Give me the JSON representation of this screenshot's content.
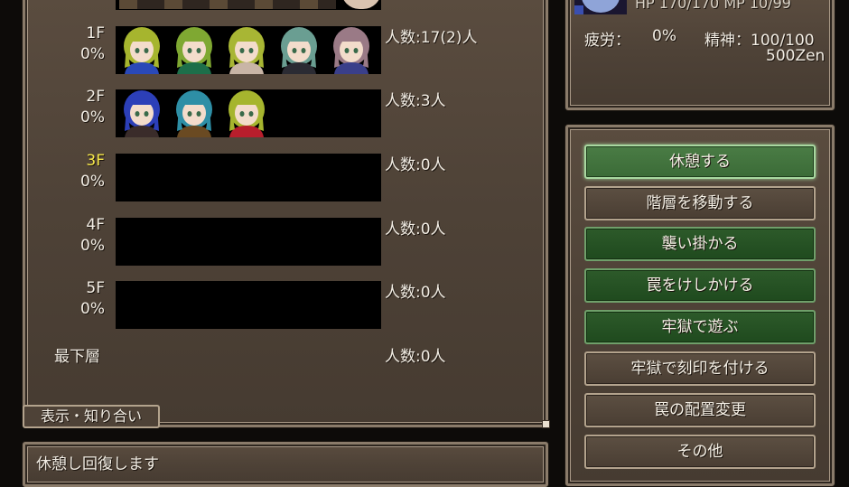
{
  "status": {
    "hp_mp": "HP 170/170 MP 10/99",
    "fatigue_label": "疲労：",
    "fatigue_value": "0%",
    "spirit": "精神：100/100",
    "money": "500Zen"
  },
  "floors": [
    {
      "name": "1F",
      "percent": "0%",
      "count": "人数:17(2)人",
      "highlight": false,
      "portraits": [
        {
          "hair": "#a6b52e",
          "outfit": "#2a49b8"
        },
        {
          "hair": "#7fa832",
          "outfit": "#1d6f4a"
        },
        {
          "hair": "#a8b634",
          "outfit": "#c9b5a6"
        },
        {
          "hair": "#6a9e92",
          "outfit": "#2b2b33"
        },
        {
          "hair": "#9a7a86",
          "outfit": "#3a3f8a"
        }
      ]
    },
    {
      "name": "2F",
      "percent": "0%",
      "count": "人数:3人",
      "highlight": false,
      "portraits": [
        {
          "hair": "#2c3fb8",
          "outfit": "#3a2c2a"
        },
        {
          "hair": "#2e8fa6",
          "outfit": "#6a4a22"
        },
        {
          "hair": "#a6b52e",
          "outfit": "#b81e2c"
        }
      ]
    },
    {
      "name": "3F",
      "percent": "0%",
      "count": "人数:0人",
      "highlight": true,
      "portraits": []
    },
    {
      "name": "4F",
      "percent": "0%",
      "count": "人数:0人",
      "highlight": false,
      "portraits": []
    },
    {
      "name": "5F",
      "percent": "0%",
      "count": "人数:0人",
      "highlight": false,
      "portraits": []
    }
  ],
  "bottom_floor": {
    "name": "最下層",
    "count": "人数:0人"
  },
  "tab_label": "表示・知り合い",
  "message": "休憩し回復します",
  "menu": [
    {
      "label": "休憩する",
      "style": "sel"
    },
    {
      "label": "階層を移動する",
      "style": "brown"
    },
    {
      "label": "襲い掛かる",
      "style": "green"
    },
    {
      "label": "罠をけしかける",
      "style": "green"
    },
    {
      "label": "牢獄で遊ぶ",
      "style": "green"
    },
    {
      "label": "牢獄で刻印を付ける",
      "style": "brown"
    },
    {
      "label": "罠の配置変更",
      "style": "brown"
    },
    {
      "label": "その他",
      "style": "brown"
    }
  ],
  "colors": {
    "highlight_floor": "#f5e64a"
  }
}
